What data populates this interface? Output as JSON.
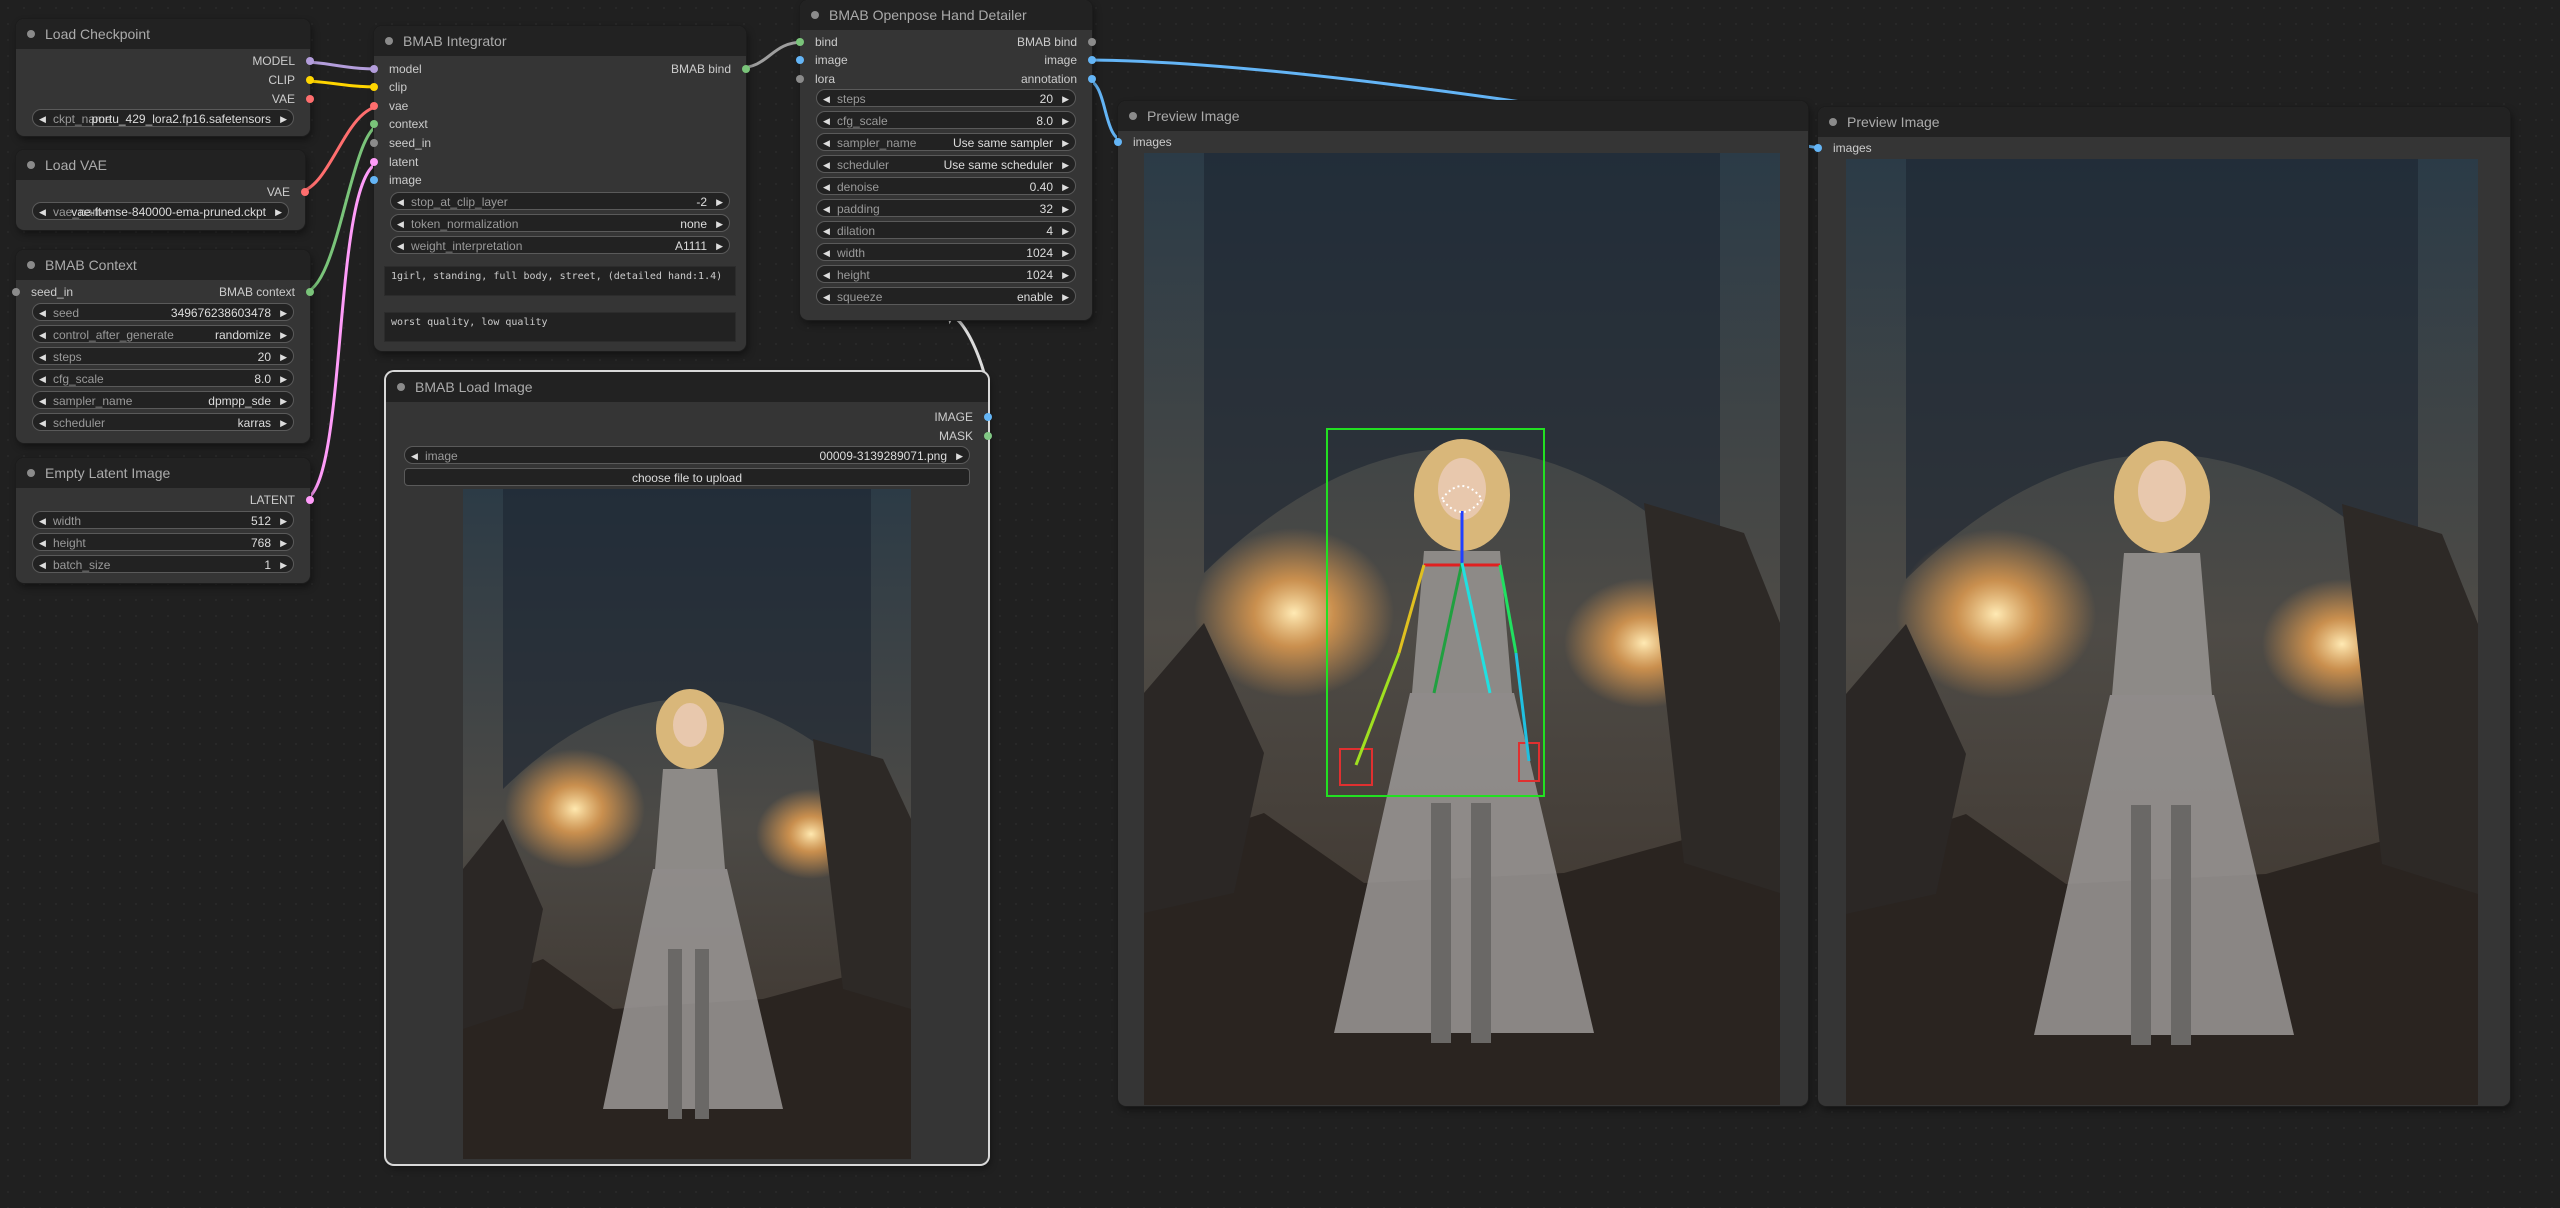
{
  "colors": {
    "model": "#b39ddb",
    "clip": "#ffd500",
    "vae": "#ff6e6e",
    "latent": "#ff9cf9",
    "image": "#64b5f6",
    "mask": "#81c784",
    "bind": "#7ac47a",
    "generic": "#8b8b8b"
  },
  "load_checkpoint": {
    "title": "Load Checkpoint",
    "outputs": [
      "MODEL",
      "CLIP",
      "VAE"
    ],
    "ckpt_label": "ckpt_name",
    "ckpt_value": "portu_429_lora2.fp16.safetensors"
  },
  "load_vae": {
    "title": "Load VAE",
    "output": "VAE",
    "vae_label": "vae_name",
    "vae_value": "vae-ft-mse-840000-ema-pruned.ckpt"
  },
  "context": {
    "title": "BMAB Context",
    "input": "seed_in",
    "output": "BMAB context",
    "widgets": [
      {
        "label": "seed",
        "value": "349676238603478"
      },
      {
        "label": "control_after_generate",
        "value": "randomize"
      },
      {
        "label": "steps",
        "value": "20"
      },
      {
        "label": "cfg_scale",
        "value": "8.0"
      },
      {
        "label": "sampler_name",
        "value": "dpmpp_sde"
      },
      {
        "label": "scheduler",
        "value": "karras"
      }
    ]
  },
  "latent": {
    "title": "Empty Latent Image",
    "output": "LATENT",
    "widgets": [
      {
        "label": "width",
        "value": "512"
      },
      {
        "label": "height",
        "value": "768"
      },
      {
        "label": "batch_size",
        "value": "1"
      }
    ]
  },
  "integrator": {
    "title": "BMAB Integrator",
    "inputs": [
      "model",
      "clip",
      "vae",
      "context",
      "seed_in",
      "latent",
      "image"
    ],
    "output": "BMAB bind",
    "widgets": [
      {
        "label": "stop_at_clip_layer",
        "value": "-2"
      },
      {
        "label": "token_normalization",
        "value": "none"
      },
      {
        "label": "weight_interpretation",
        "value": "A1111"
      }
    ],
    "positive_prompt": "1girl, standing, full body, street, (detailed hand:1.4)",
    "negative_prompt": "worst quality, low quality"
  },
  "hand_detailer": {
    "title": "BMAB Openpose Hand Detailer",
    "inputs": [
      "bind",
      "image",
      "lora"
    ],
    "outputs": [
      "BMAB bind",
      "image",
      "annotation"
    ],
    "widgets": [
      {
        "label": "steps",
        "value": "20"
      },
      {
        "label": "cfg_scale",
        "value": "8.0"
      },
      {
        "label": "sampler_name",
        "value": "Use same sampler"
      },
      {
        "label": "scheduler",
        "value": "Use same scheduler"
      },
      {
        "label": "denoise",
        "value": "0.40"
      },
      {
        "label": "padding",
        "value": "32"
      },
      {
        "label": "dilation",
        "value": "4"
      },
      {
        "label": "width",
        "value": "1024"
      },
      {
        "label": "height",
        "value": "1024"
      },
      {
        "label": "squeeze",
        "value": "enable"
      }
    ]
  },
  "load_image": {
    "title": "BMAB Load Image",
    "outputs": [
      "IMAGE",
      "MASK"
    ],
    "image_label": "image",
    "image_value": "00009-3139289071.png",
    "upload_label": "choose file to upload"
  },
  "preview1": {
    "title": "Preview Image",
    "input": "images"
  },
  "preview2": {
    "title": "Preview Image",
    "input": "images"
  }
}
